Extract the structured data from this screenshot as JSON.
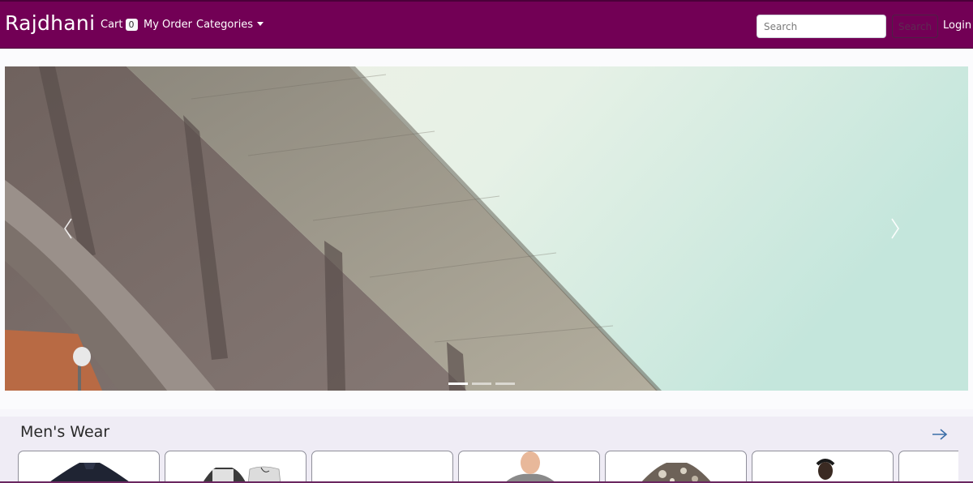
{
  "navbar": {
    "brand": "Rajdhani",
    "cart_label": "Cart",
    "cart_count": "0",
    "my_order_label": "My Order",
    "categories_label": "Categories",
    "search_placeholder": "Search",
    "search_button_label": "Search",
    "login_label": "Login",
    "background_color": "#720055"
  },
  "carousel": {
    "prev_icon": "chevron-left-icon",
    "next_icon": "chevron-right-icon",
    "slide_count": 3,
    "active_slide": 1
  },
  "section": {
    "title": "Men's Wear",
    "next_icon": "arrow-right-icon",
    "products": [
      {
        "icon": "navy-shirt-image"
      },
      {
        "icon": "shirt-and-shorts-image"
      },
      {
        "icon": "empty-product-image"
      },
      {
        "icon": "man-in-grey-shirt-image"
      },
      {
        "icon": "floral-shirt-image"
      },
      {
        "icon": "man-portrait-image"
      },
      {
        "icon": "product-image"
      }
    ]
  }
}
